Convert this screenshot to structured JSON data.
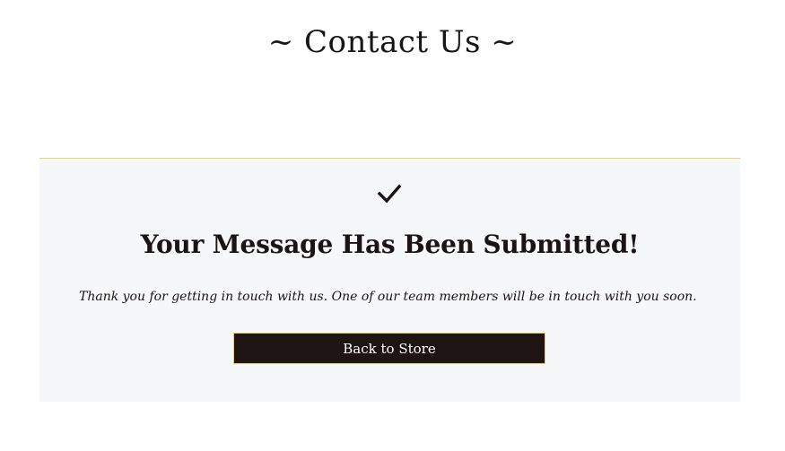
{
  "header": {
    "title": "~ Contact Us ~"
  },
  "confirmation": {
    "icon": "checkmark-icon",
    "heading": "Your Message Has Been Submitted!",
    "message": "Thank you for getting in touch with us. One of our team members will be in touch with you soon.",
    "button_label": "Back to Store"
  },
  "colors": {
    "panel_background": "#f6f7f8",
    "accent_border": "#e4d46a",
    "button_background": "#1e1414",
    "text": "#1b1414"
  }
}
